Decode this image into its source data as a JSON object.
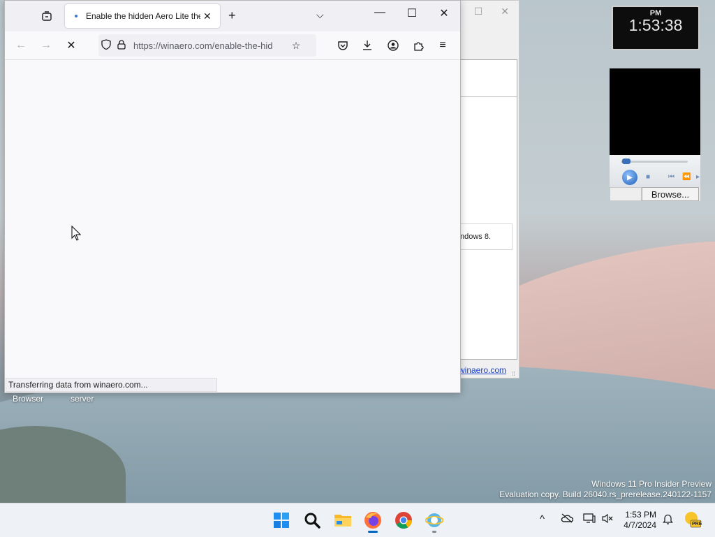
{
  "browser": {
    "tab_title": "Enable the hidden Aero Lite the",
    "url": "https://winaero.com/enable-the-hid",
    "status_text": "Transferring data from winaero.com..."
  },
  "back_window": {
    "box_text": "ndows 8.",
    "link_text": "winaero.com"
  },
  "desktop": {
    "icon_labels": [
      "Browser",
      "server"
    ]
  },
  "clock_gadget": {
    "ampm": "PM",
    "time": "1:53:38"
  },
  "media_gadget": {
    "browse_label": "Browse..."
  },
  "watermark": {
    "line1": "Windows 11 Pro Insider Preview",
    "line2": "Evaluation copy. Build 26040.rs_prerelease.240122-1157"
  },
  "taskbar": {
    "time": "1:53 PM",
    "date": "4/7/2024",
    "apps": [
      "start-icon",
      "search-icon",
      "file-explorer-icon",
      "firefox-icon",
      "chrome-icon",
      "ie-icon"
    ],
    "tray": [
      "chevron-up-icon",
      "onedrive-icon",
      "display-icon",
      "volume-mute-icon",
      "notification-bell-icon",
      "insider-pre-icon"
    ],
    "tray_badge": "PRE"
  }
}
